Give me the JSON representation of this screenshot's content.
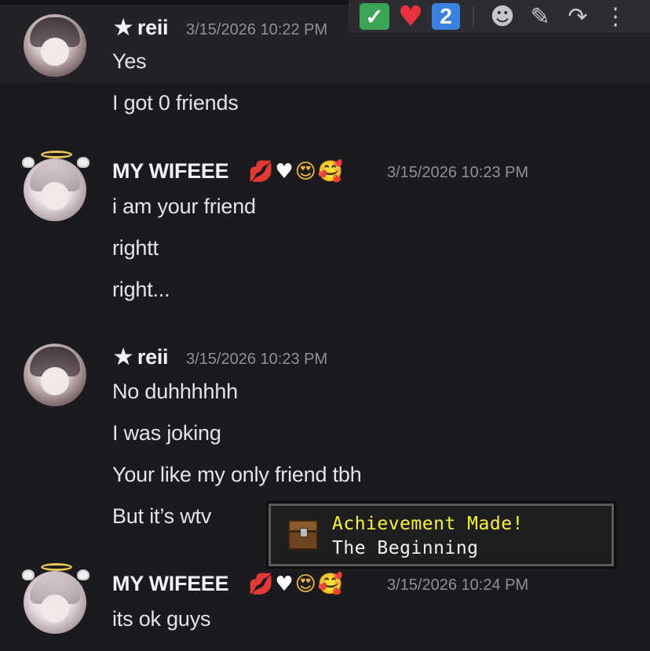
{
  "toolbar": {
    "reactions": [
      {
        "icon": "check-icon",
        "glyph": "✓"
      },
      {
        "icon": "heart-icon",
        "glyph": "♥"
      },
      {
        "icon": "keycap-two-icon",
        "glyph": "2"
      }
    ],
    "actions": [
      {
        "icon": "add-reaction-icon",
        "glyph": "☻"
      },
      {
        "icon": "edit-icon",
        "glyph": "✎"
      },
      {
        "icon": "forward-icon",
        "glyph": "↷"
      },
      {
        "icon": "more-icon",
        "glyph": "⋮"
      }
    ]
  },
  "messages": [
    {
      "author": "reii",
      "author_prefix": "★",
      "timestamp": "3/15/2026 10:22 PM",
      "lines": [
        "Yes",
        "I got 0 friends"
      ]
    },
    {
      "author": "MY WIFEEE",
      "author_emojis": [
        "💋",
        "♥",
        "😍",
        "🥰"
      ],
      "timestamp": "3/15/2026 10:23 PM",
      "lines": [
        "i am your friend",
        "rightt",
        "right..."
      ]
    },
    {
      "author": "reii",
      "author_prefix": "★",
      "timestamp": "3/15/2026 10:23 PM",
      "lines": [
        "No duhhhhhh",
        "I was joking",
        "Your like my only friend tbh",
        "But it’s wtv"
      ]
    },
    {
      "author": "MY WIFEEE",
      "author_emojis": [
        "💋",
        "♥",
        "😍",
        "🥰"
      ],
      "timestamp": "3/15/2026 10:24 PM",
      "lines": [
        "its ok guys"
      ]
    }
  ],
  "toast": {
    "title": "Achievement Made!",
    "subtitle": "The Beginning",
    "icon": "chest-icon"
  },
  "colors": {
    "background": "#1b1b1f",
    "hover_row": "#232327",
    "timestamp": "#8e9096",
    "toast_title": "#f8f53a"
  }
}
